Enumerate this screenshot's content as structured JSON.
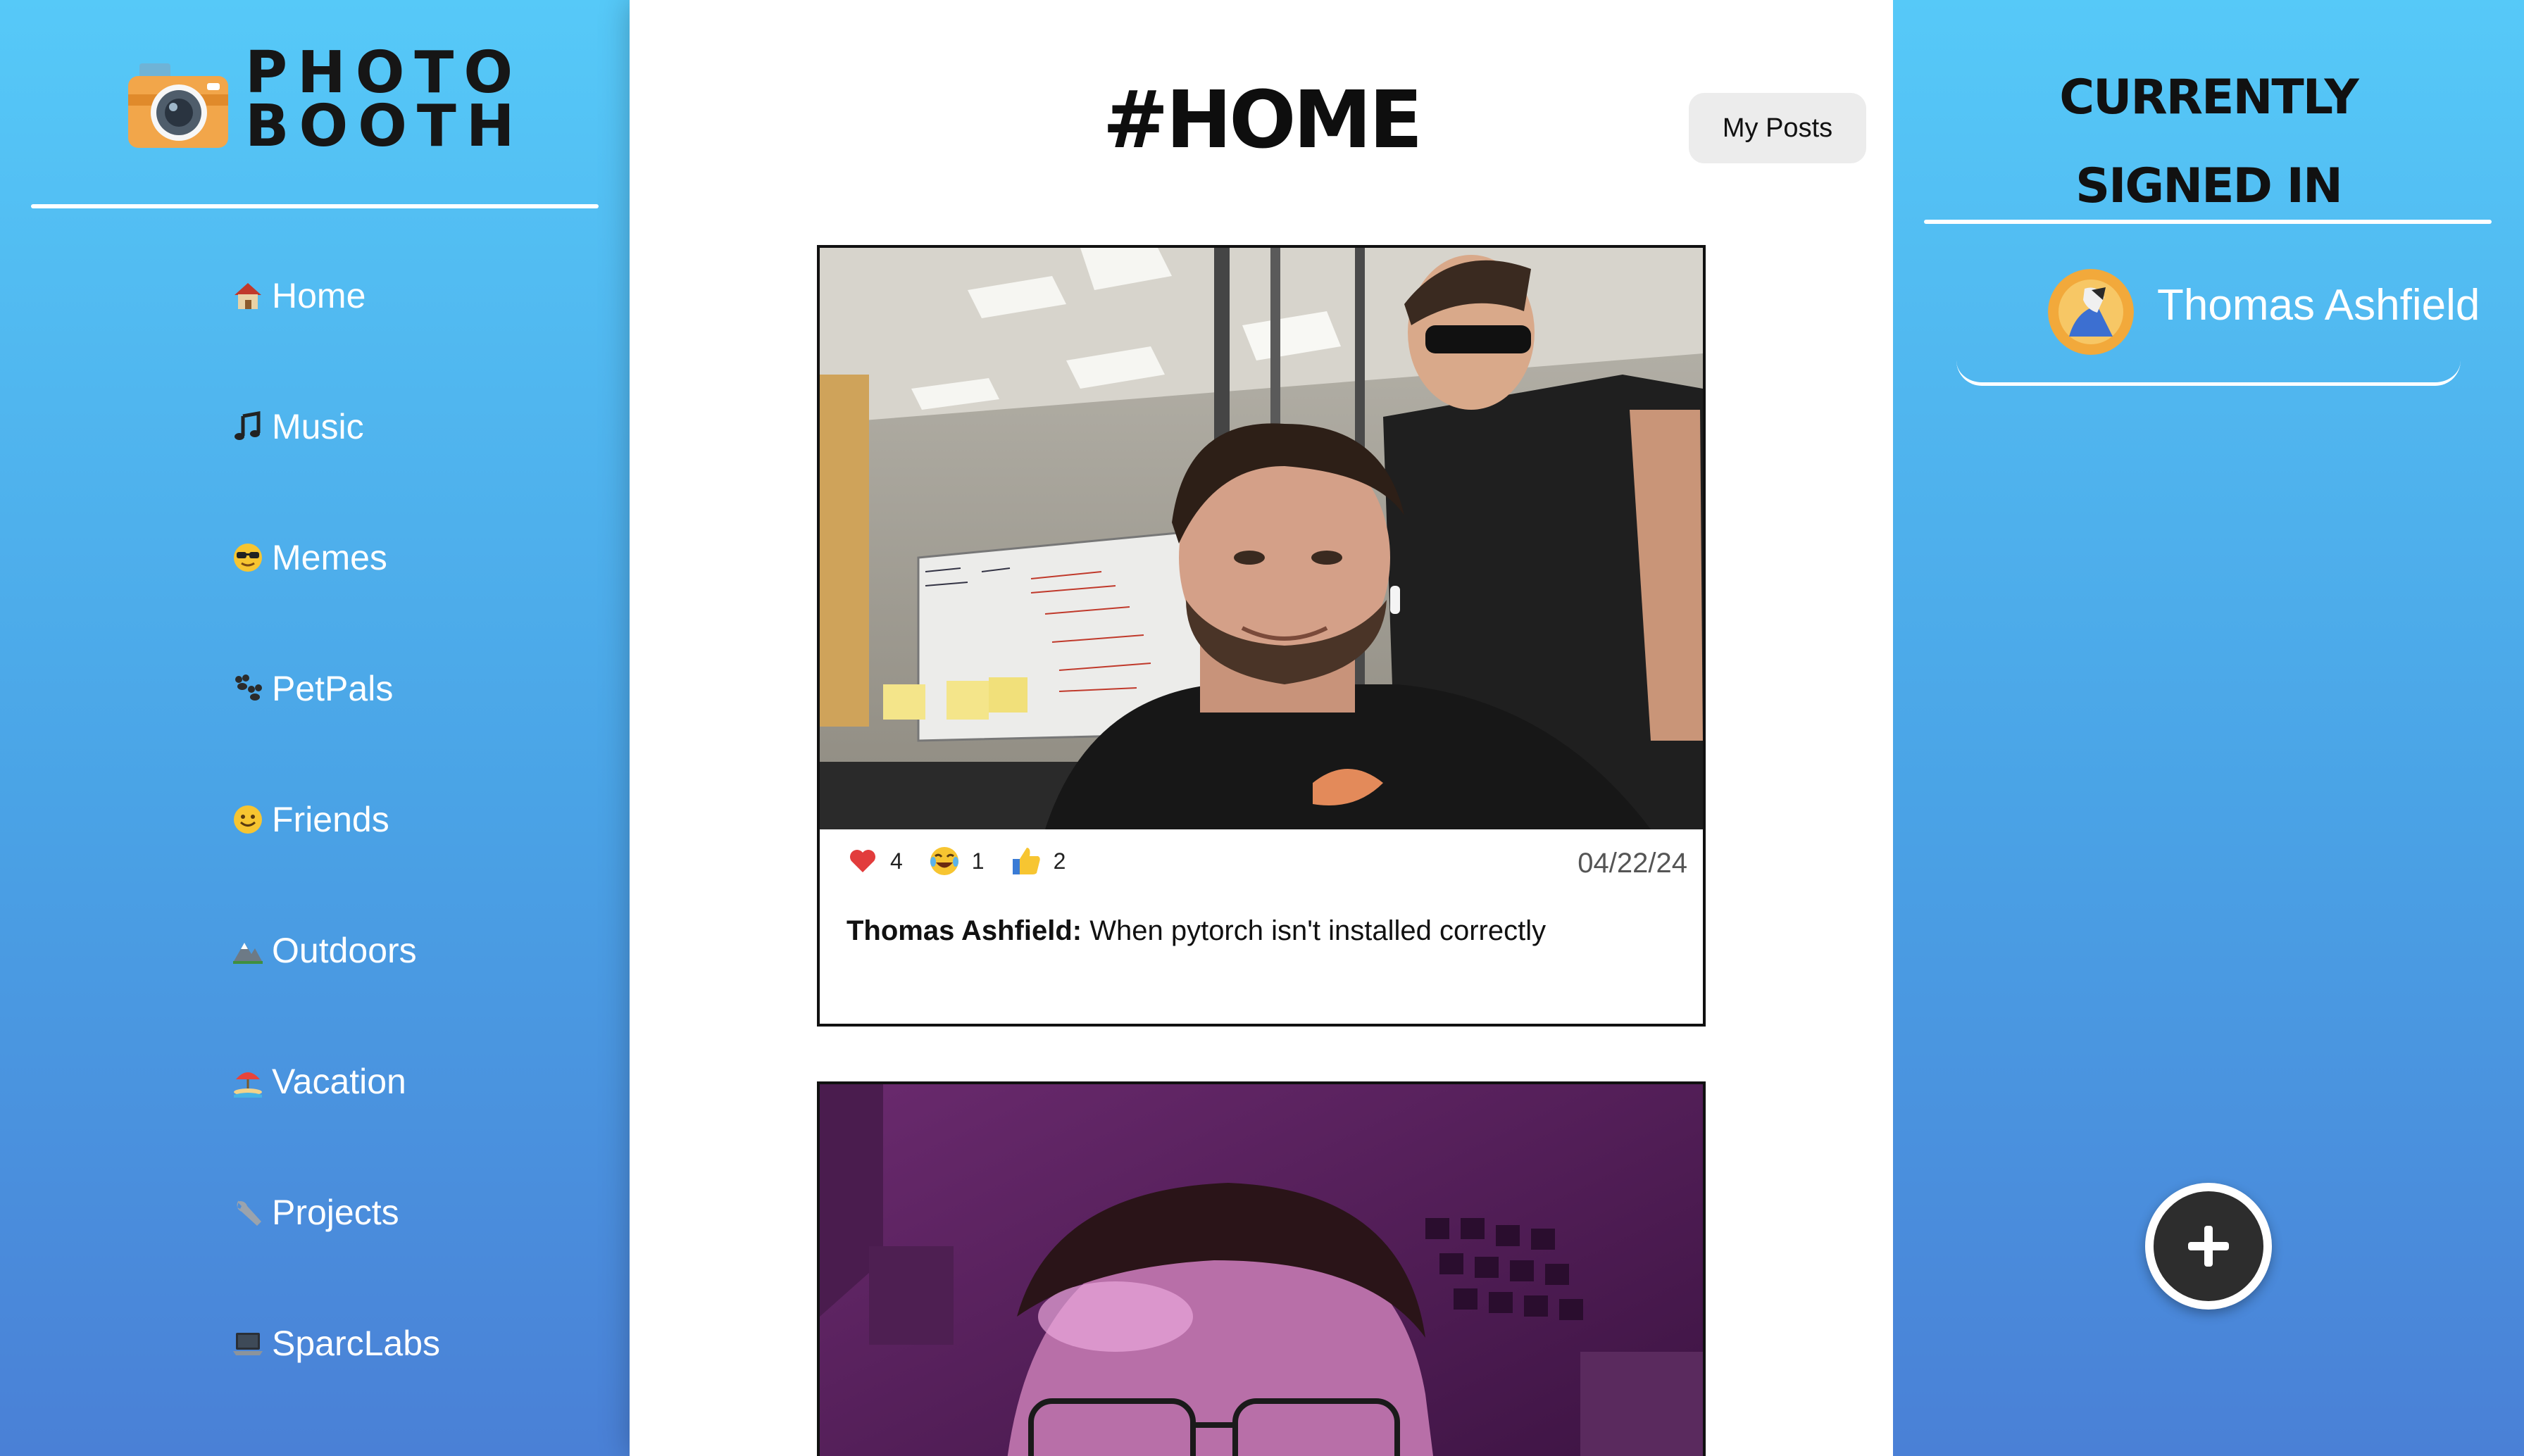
{
  "brand": {
    "line1": "PHOTO",
    "line2": "BOOTH",
    "icon": "camera-icon"
  },
  "nav": {
    "items": [
      {
        "label": "Home",
        "icon": "house-icon"
      },
      {
        "label": "Music",
        "icon": "music-note-icon"
      },
      {
        "label": "Memes",
        "icon": "sunglasses-face-icon"
      },
      {
        "label": "PetPals",
        "icon": "paw-prints-icon"
      },
      {
        "label": "Friends",
        "icon": "smiley-face-icon"
      },
      {
        "label": "Outdoors",
        "icon": "mountain-icon"
      },
      {
        "label": "Vacation",
        "icon": "beach-umbrella-icon"
      },
      {
        "label": "Projects",
        "icon": "wrench-icon"
      },
      {
        "label": "SparcLabs",
        "icon": "laptop-icon"
      }
    ]
  },
  "main": {
    "title": "#HOME",
    "my_posts_label": "My Posts",
    "posts": [
      {
        "reactions": [
          {
            "icon": "heart-icon",
            "count": "4"
          },
          {
            "icon": "laughing-face-icon",
            "count": "1"
          },
          {
            "icon": "thumbs-up-icon",
            "count": "2"
          }
        ],
        "date": "04/22/24",
        "author": "Thomas Ashfield:",
        "caption": " When pytorch isn't installed correctly"
      },
      {}
    ]
  },
  "signed_in": {
    "title_line1": "CURRENTLY",
    "title_line2": "SIGNED IN",
    "user_name": "Thomas Ashfield"
  },
  "add_button_icon": "plus-icon"
}
